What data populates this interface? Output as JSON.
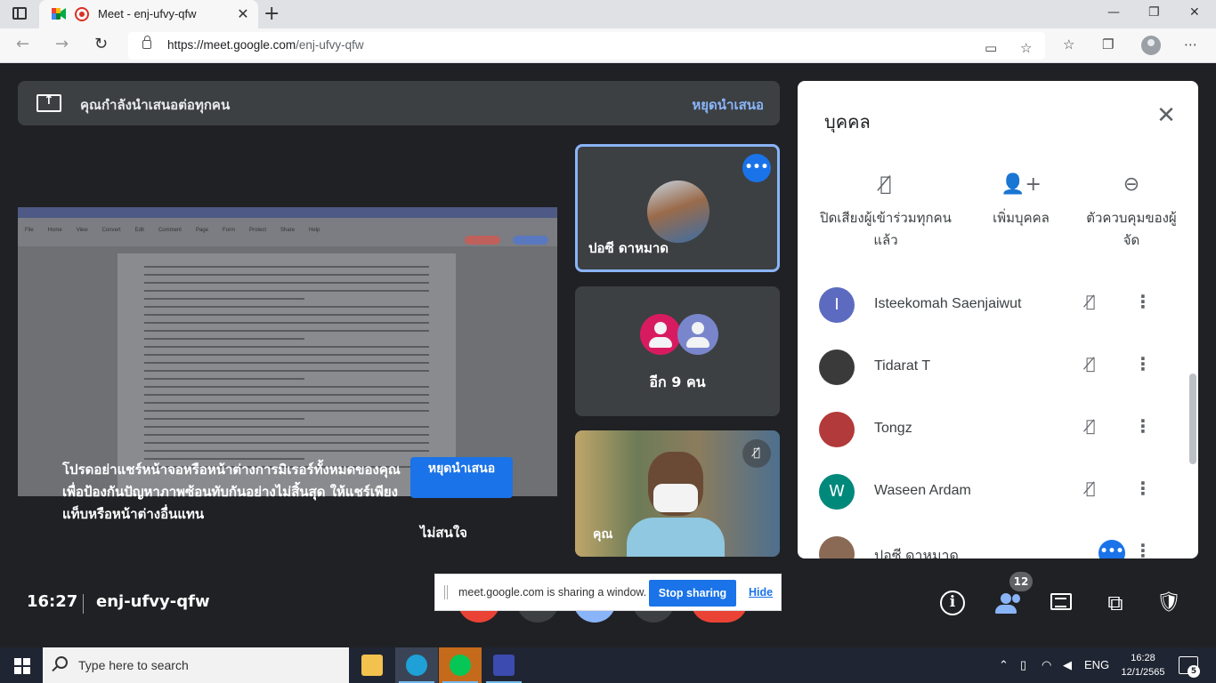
{
  "browser": {
    "tab_title": "Meet - enj-ufvy-qfw",
    "tab_close": "✕",
    "new_tab": "+",
    "url_domain": "https://meet.google.com",
    "url_path": "/enj-ufvy-qfw",
    "window_controls": [
      "—",
      "❐",
      "✕"
    ]
  },
  "banner": {
    "text": "คุณกำลังนำเสนอต่อทุกคน",
    "stop_link": "หยุดนำเสนอ"
  },
  "shared_doc": {
    "menu_items": [
      "File",
      "Home",
      "View",
      "Convert",
      "Edit",
      "Comment",
      "Page",
      "Form",
      "Protect",
      "Share",
      "Help"
    ]
  },
  "overlay": {
    "message": "โปรดอย่าแชร์หน้าจอหรือหน้าต่างการมิเรอร์ทั้งหมดของคุณ เพื่อป้องกันปัญหาภาพซ้อนทับกันอย่างไม่สิ้นสุด ให้แชร์เพียงแท็บหรือหน้าต่างอื่นแทน",
    "stop_button": "หยุดนำเสนอ",
    "dismiss": "ไม่สนใจ"
  },
  "tiles": {
    "main_name": "ปอซี ดาหมาด",
    "more_label": "อีก 9 คน",
    "self_label": "คุณ"
  },
  "meeting": {
    "time": "16:27",
    "code": "enj-ufvy-qfw",
    "participant_count": "12"
  },
  "sharing_bar": {
    "text": "meet.google.com is sharing a window.",
    "stop": "Stop sharing",
    "hide": "Hide"
  },
  "panel": {
    "title": "บุคคล",
    "actions": [
      {
        "label": "ปิดเสียงผู้เข้าร่วมทุกคนแล้ว",
        "icon": "mic-off-icon"
      },
      {
        "label": "เพิ่มบุคคล",
        "icon": "person-add-icon"
      },
      {
        "label": "ตัวควบคุมของผู้จัด",
        "icon": "toggle-icon"
      }
    ],
    "people": [
      {
        "name": "Isteekomah Saenjaiwut",
        "initial": "I",
        "color": "#5c6bc0"
      },
      {
        "name": "Tidarat T",
        "initial": "",
        "color": "#3a3a3a"
      },
      {
        "name": "Tongz",
        "initial": "",
        "color": "#b23a3a"
      },
      {
        "name": "Waseen Ardam",
        "initial": "W",
        "color": "#00897b"
      },
      {
        "name": "ปอซี ดาหมาด",
        "initial": "",
        "color": "#8a6a55"
      }
    ]
  },
  "taskbar": {
    "search_placeholder": "Type here to search",
    "lang": "ENG",
    "time": "16:28",
    "date": "12/1/2565",
    "notifications": "5"
  }
}
